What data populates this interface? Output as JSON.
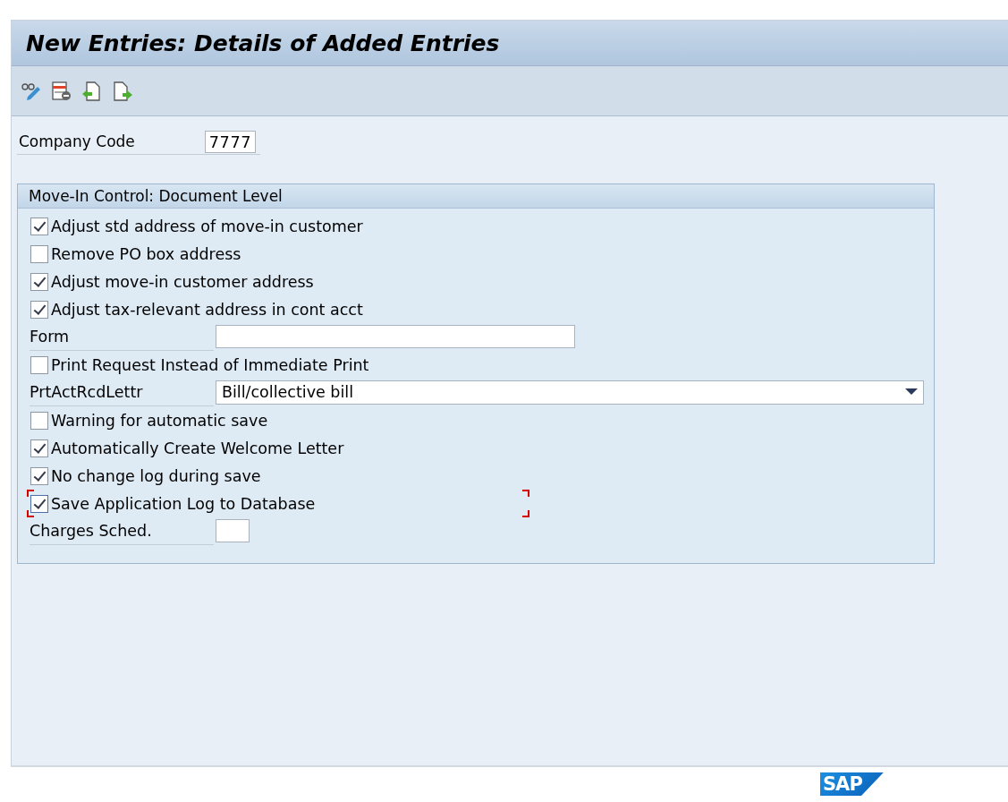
{
  "window": {
    "title": "New Entries: Details of Added Entries"
  },
  "toolbar": {
    "buttons": [
      {
        "kind": "display-change"
      },
      {
        "kind": "delete"
      },
      {
        "kind": "previous"
      },
      {
        "kind": "next"
      }
    ]
  },
  "header_field": {
    "label": "Company Code",
    "value": "7777"
  },
  "group": {
    "title": "Move-In Control: Document Level",
    "rows": [
      {
        "kind": "checkbox",
        "label": "Adjust std address of move-in customer",
        "checked": true,
        "focused": false
      },
      {
        "kind": "checkbox",
        "label": "Remove PO box address",
        "checked": false,
        "focused": false
      },
      {
        "kind": "checkbox",
        "label": "Adjust move-in customer address",
        "checked": true,
        "focused": false
      },
      {
        "kind": "checkbox",
        "label": "Adjust tax-relevant address in cont acct",
        "checked": true,
        "focused": false
      },
      {
        "kind": "long-input",
        "label": "Form"
      },
      {
        "kind": "checkbox",
        "label": "Print Request Instead of Immediate Print",
        "checked": false,
        "focused": false
      },
      {
        "kind": "dropdown",
        "label": "PrtActRcdLettr",
        "value": "Bill/collective bill"
      },
      {
        "kind": "checkbox",
        "label": "Warning for automatic save",
        "checked": false,
        "focused": false
      },
      {
        "kind": "checkbox",
        "label": "Automatically Create Welcome Letter",
        "checked": true,
        "focused": false
      },
      {
        "kind": "checkbox",
        "label": "No change log during save",
        "checked": true,
        "focused": false
      },
      {
        "kind": "checkbox",
        "label": "Save Application Log to Database",
        "checked": true,
        "focused": true
      },
      {
        "kind": "short-input",
        "label": "Charges Sched."
      }
    ]
  },
  "footer": {
    "logo": "SAP"
  }
}
